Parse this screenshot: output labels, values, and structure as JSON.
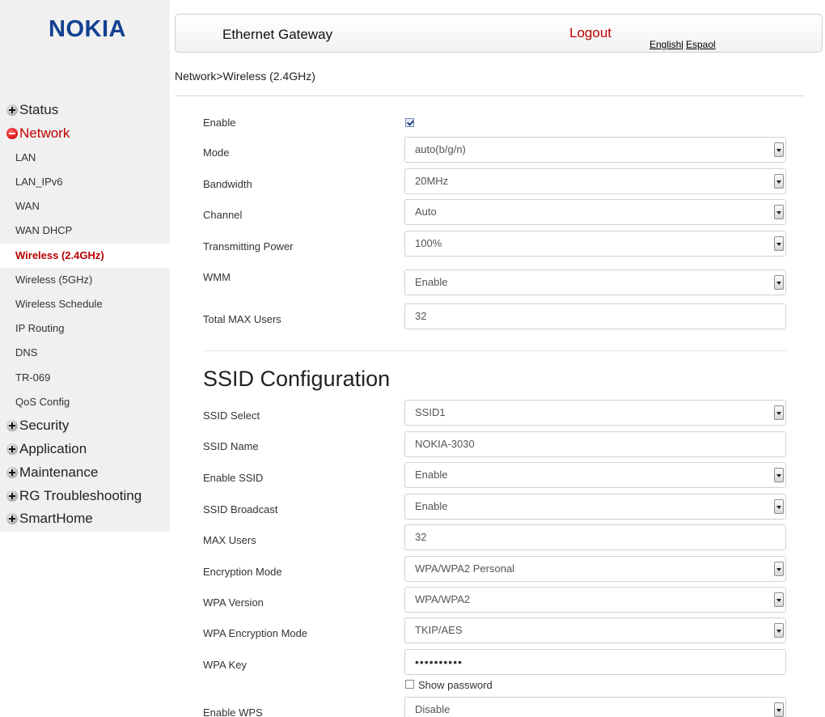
{
  "brand": {
    "logo_text": "NOKIA",
    "color": "#124191"
  },
  "header": {
    "title": "Ethernet Gateway",
    "logout": "Logout",
    "lang_en": "English",
    "lang_sep": "|",
    "lang_es": "Espaol"
  },
  "breadcrumb": "Network>Wireless (2.4GHz)",
  "sidebar": {
    "top": {
      "status": "Status",
      "network": "Network",
      "security": "Security",
      "application": "Application",
      "maintenance": "Maintenance",
      "rg_troubleshooting": "RG Troubleshooting",
      "smarthome": "SmartHome"
    },
    "sub": [
      "LAN",
      "LAN_IPv6",
      "WAN",
      "WAN DHCP",
      "Wireless (2.4GHz)",
      "Wireless (5GHz)",
      "Wireless Schedule",
      "IP Routing",
      "DNS",
      "TR-069",
      "QoS Config"
    ],
    "active_item": "Wireless (2.4GHz)",
    "active_color": "#b50000"
  },
  "wireless": {
    "enable_label": "Enable",
    "enable_checked": true,
    "mode_label": "Mode",
    "mode_value": "auto(b/g/n)",
    "bandwidth_label": "Bandwidth",
    "bandwidth_value": "20MHz",
    "channel_label": "Channel",
    "channel_value": "Auto",
    "tx_power_label": "Transmitting Power",
    "tx_power_value": "100%",
    "wmm_label": "WMM",
    "wmm_value": "Enable",
    "total_max_users_label": "Total MAX Users",
    "total_max_users_value": "32"
  },
  "ssid": {
    "section_title": "SSID Configuration",
    "select_label": "SSID Select",
    "select_value": "SSID1",
    "name_label": "SSID Name",
    "name_value": "NOKIA-3030",
    "enable_label": "Enable SSID",
    "enable_value": "Enable",
    "broadcast_label": "SSID Broadcast",
    "broadcast_value": "Enable",
    "max_users_label": "MAX Users",
    "max_users_value": "32",
    "encryption_label": "Encryption Mode",
    "encryption_value": "WPA/WPA2 Personal",
    "wpa_version_label": "WPA Version",
    "wpa_version_value": "WPA/WPA2",
    "wpa_enc_label": "WPA Encryption Mode",
    "wpa_enc_value": "TKIP/AES",
    "wpa_key_label": "WPA Key",
    "wpa_key_value": "••••••••••",
    "show_password_label": "Show password",
    "show_password_checked": false,
    "wps_label": "Enable WPS",
    "wps_value": "Disable"
  }
}
